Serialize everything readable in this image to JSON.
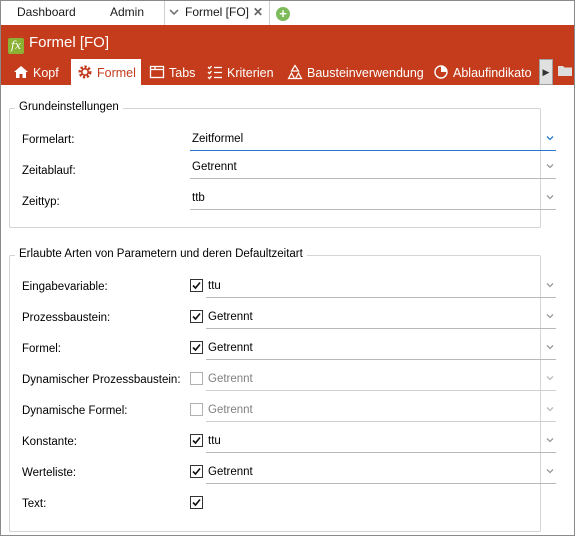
{
  "top_tabs": [
    {
      "label": "Dashboard"
    },
    {
      "label": "Admin"
    },
    {
      "label": "Formel [FO]",
      "active": true
    }
  ],
  "window": {
    "title": "Formel [FO]",
    "icon": "formula-icon",
    "accent": "#c43c1c"
  },
  "tabs": [
    {
      "label": "Kopf",
      "icon": "home-icon"
    },
    {
      "label": "Formel",
      "icon": "gear-icon",
      "active": true
    },
    {
      "label": "Tabs",
      "icon": "tabs-icon"
    },
    {
      "label": "Kriterien",
      "icon": "checklist-icon"
    },
    {
      "label": "Bausteinverwendung",
      "icon": "shapes-icon"
    },
    {
      "label": "Ablaufindikato",
      "icon": "pie-icon"
    }
  ],
  "grund": {
    "title": "Grundeinstellungen",
    "rows": [
      {
        "label": "Formelart:",
        "value": "Zeitformel"
      },
      {
        "label": "Zeitablauf:",
        "value": "Getrennt"
      },
      {
        "label": "Zeittyp:",
        "value": "ttb"
      }
    ]
  },
  "params": {
    "title": "Erlaubte Arten von Parametern und deren Defaultzeitart",
    "rows": [
      {
        "label": "Eingabevariable:",
        "checked": true,
        "value": "ttu"
      },
      {
        "label": "Prozessbaustein:",
        "checked": true,
        "value": "Getrennt"
      },
      {
        "label": "Formel:",
        "checked": true,
        "value": "Getrennt"
      },
      {
        "label": "Dynamischer Prozessbaustein:",
        "checked": false,
        "value": "Getrennt"
      },
      {
        "label": "Dynamische Formel:",
        "checked": false,
        "value": "Getrennt"
      },
      {
        "label": "Konstante:",
        "checked": true,
        "value": "ttu"
      },
      {
        "label": "Werteliste:",
        "checked": true,
        "value": "Getrennt"
      },
      {
        "label": "Text:",
        "checked": true,
        "value": ""
      }
    ]
  }
}
